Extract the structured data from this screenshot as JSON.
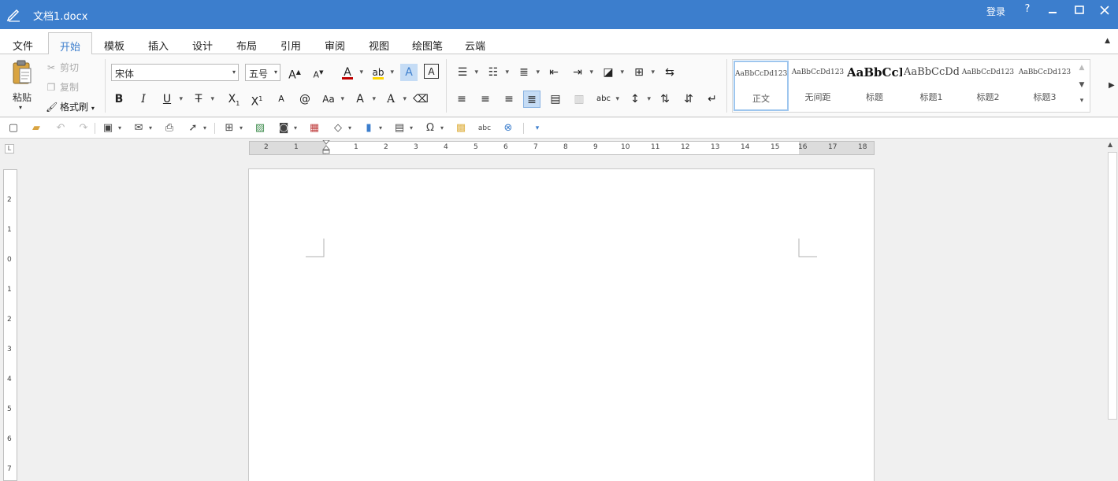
{
  "titlebar": {
    "doc_title": "文档1.docx",
    "login": "登录",
    "help": "?"
  },
  "menu": {
    "tabs": [
      "文件",
      "开始",
      "模板",
      "插入",
      "设计",
      "布局",
      "引用",
      "审阅",
      "视图",
      "绘图笔",
      "云端"
    ],
    "active": "开始"
  },
  "clipboard": {
    "paste": "粘贴",
    "cut": "剪切",
    "copy": "复制",
    "format_painter": "格式刷"
  },
  "font": {
    "family": "宋体",
    "size": "五号",
    "font_color": "#c00000",
    "highlight_color": "#ffd700"
  },
  "styles": [
    {
      "sample": "AaBbCcDd123",
      "name": "正文"
    },
    {
      "sample": "AaBbCcDd123",
      "name": "无间距"
    },
    {
      "sample": "AaBbCcI",
      "name": "标题"
    },
    {
      "sample": "AaBbCcDd1",
      "name": "标题1"
    },
    {
      "sample": "AaBbCcDd123",
      "name": "标题2"
    },
    {
      "sample": "AaBbCcDd123",
      "name": "标题3"
    }
  ],
  "ruler": {
    "h_left": [
      "2",
      "1"
    ],
    "h_right": [
      "1",
      "2",
      "3",
      "4",
      "5",
      "6",
      "7",
      "8",
      "9",
      "10",
      "11",
      "12",
      "13",
      "14",
      "15",
      "16",
      "17",
      "18"
    ],
    "v": [
      "2",
      "1",
      "0",
      "1",
      "2",
      "3",
      "4",
      "5",
      "6",
      "7"
    ]
  },
  "colors": {
    "title_bar": "#3c7ecd",
    "accent": "#3c7ecd"
  }
}
